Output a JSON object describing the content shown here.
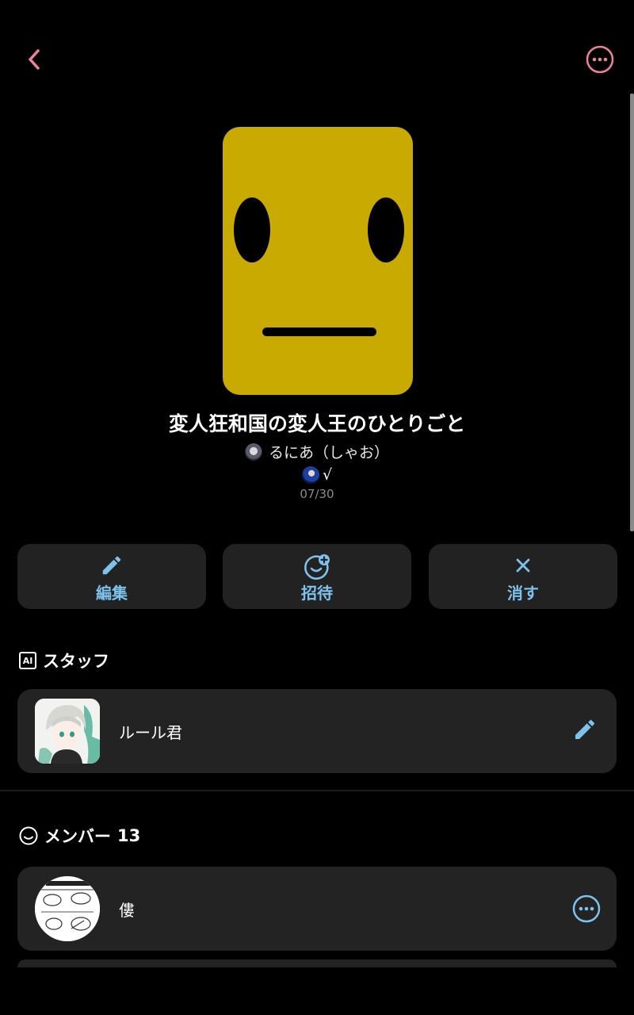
{
  "colors": {
    "accent_pink": "#f0819c",
    "accent_blue": "#7cc2ec",
    "card_bg": "#232323",
    "cover_bg": "#c8aa00"
  },
  "nav": {
    "back_icon": "chevron-left-icon",
    "more_icon": "more-horizontal-circle-icon"
  },
  "album": {
    "title": "変人狂和国の変人王のひとりごと",
    "owner_name": "るにあ（しゃお）",
    "sub_text": "√",
    "date": "07/30"
  },
  "actions": [
    {
      "label": "編集",
      "icon": "pencil-icon"
    },
    {
      "label": "招待",
      "icon": "invite-smile-plus-icon"
    },
    {
      "label": "消す",
      "icon": "close-icon"
    }
  ],
  "staff": {
    "title": "スタッフ",
    "badge": "AI",
    "items": [
      {
        "name": "ルール君",
        "action_icon": "pencil-icon"
      }
    ]
  },
  "members": {
    "title": "メンバー",
    "count": "13",
    "items": [
      {
        "name": "僂",
        "action_icon": "more-horizontal-circle-icon"
      }
    ]
  }
}
